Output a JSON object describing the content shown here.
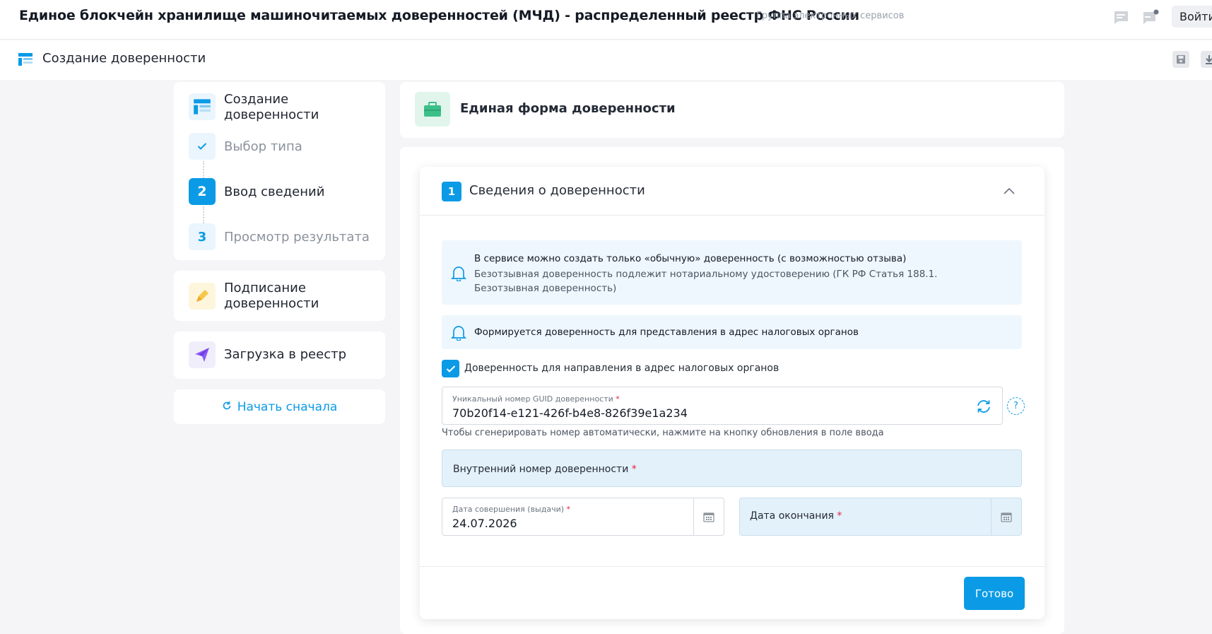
{
  "header": {
    "title": "Единое блокчейн хранилище машиночитаемых доверенностей (МЧД) - распределенный реестр ФНС России",
    "subtitle": "Группа электронных сервисов",
    "login_label": "Войти"
  },
  "subheader": {
    "page_title": "Создание доверенности"
  },
  "steps": {
    "create_title": "Создание доверенности",
    "step_type": "Выбор типа",
    "step2_number": "2",
    "step_input": "Ввод сведений",
    "step3_number": "3",
    "step_preview": "Просмотр результата",
    "sign_title": "Подписание доверенности",
    "upload_title": "Загрузка в реестр",
    "restart_label": "Начать сначала"
  },
  "form": {
    "header_title": "Единая форма доверенности",
    "section_number": "1",
    "section_title": "Сведения о доверенности",
    "notice1_line1": "В сервисе можно создать только «обычную» доверенность (с возможностью отзыва)",
    "notice1_line2": "Безотзывная доверенность подлежит нотариальному удостоверению (ГК РФ Статья 188.1. Безотзывная доверенность)",
    "notice2": "Формируется доверенность для представления в адрес налоговых органов",
    "checkbox_label": "Доверенность для направления в адрес налоговых органов",
    "guid_label": "Уникальный номер GUID доверенности",
    "guid_value": "70b20f14-e121-426f-b4e8-826f39e1a234",
    "help_mark": "?",
    "guid_hint": "Чтобы сгенерировать номер автоматически, нажмите на кнопку обновления в поле ввода",
    "internal_number_label": "Внутренний номер доверенности",
    "issue_date_label": "Дата совершения (выдачи)",
    "issue_date_value": "24.07.2026",
    "end_date_label": "Дата окончания",
    "required_mark": "*",
    "done_label": "Готово"
  },
  "colors": {
    "accent": "#0b9be6",
    "notice_bg": "#eef7fd",
    "required_field_bg": "#e3f1fb"
  }
}
